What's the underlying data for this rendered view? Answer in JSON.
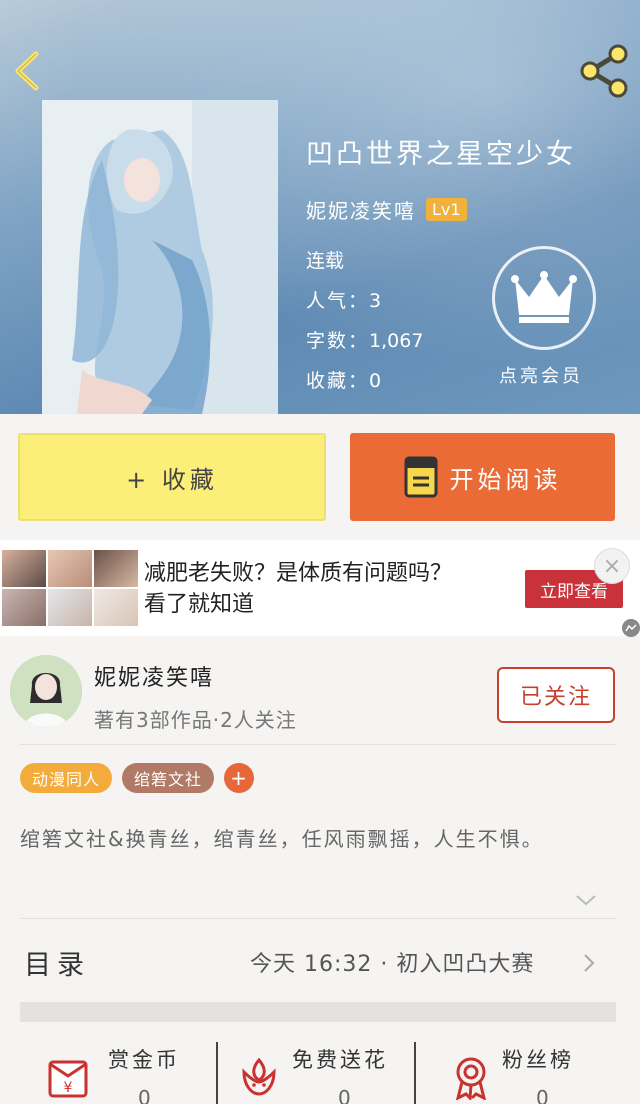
{
  "colors": {
    "accent_orange": "#ea6b35",
    "collect_yellow": "#fbef79",
    "follow_red": "#c5412d",
    "tag_orange": "#f3ac3b",
    "tag_brown": "#b07a66"
  },
  "header": {
    "back_icon": "chevron-left-icon",
    "share_icon": "share-icon",
    "book_title": "凹凸世界之星空少女",
    "author": "妮妮凌笑嘻",
    "level": "Lv1",
    "status": "连载",
    "stats": [
      {
        "label": "人气：",
        "value": "3"
      },
      {
        "label": "字数：",
        "value": "1,067"
      },
      {
        "label": "收藏：",
        "value": "0"
      }
    ],
    "vip_label": "点亮会员",
    "vip_icon": "crown-icon"
  },
  "actions": {
    "collect_label": "+ 收藏",
    "read_label": "开始阅读",
    "read_icon": "book-icon"
  },
  "ad": {
    "line1": "减肥老失败？是体质有问题吗？",
    "line2": "看了就知道",
    "cta": "立即查看",
    "close": "×"
  },
  "author_card": {
    "name": "妮妮凌笑嘻",
    "summary": "著有3部作品·2人关注",
    "follow_label": "已关注"
  },
  "tags": [
    "动漫同人",
    "绾箬文社",
    "+"
  ],
  "description": "绾箬文社&换青丝，绾青丝，任风雨飘摇，人生不惧。",
  "toc": {
    "label": "目录",
    "info": "今天 16:32 · 初入凹凸大赛"
  },
  "bottom_bar": [
    {
      "label": "赏金币",
      "value": "0",
      "icon": "red-envelope-icon"
    },
    {
      "label": "免费送花",
      "value": "0",
      "icon": "flower-icon"
    },
    {
      "label": "粉丝榜",
      "value": "0",
      "icon": "medal-icon"
    }
  ]
}
